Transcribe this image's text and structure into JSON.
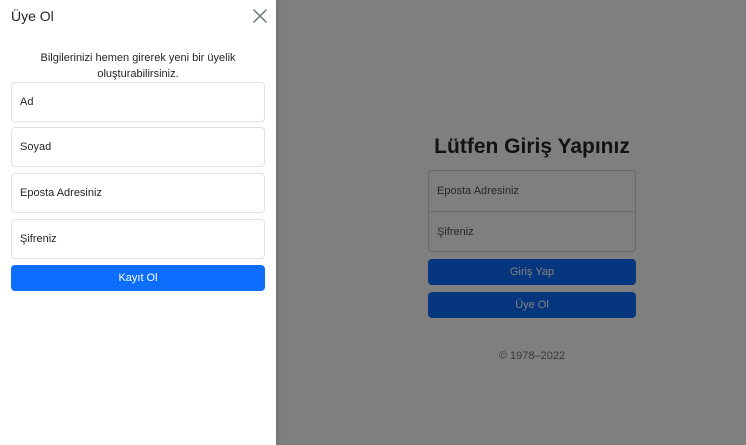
{
  "login": {
    "title": "Lütfen Giriş Yapınız",
    "email_placeholder": "Eposta Adresiniz",
    "password_placeholder": "Şifreniz",
    "login_button": "Giriş Yap",
    "register_button": "Üye Ol",
    "copyright": "© 1978–2022"
  },
  "offcanvas": {
    "title": "Üye Ol",
    "close_icon": "close-icon",
    "description": "Bilgilerinizi hemen girerek yeni bir üyelik oluşturabilirsiniz.",
    "first_name_placeholder": "Ad",
    "last_name_placeholder": "Soyad",
    "email_placeholder": "Eposta Adresiniz",
    "password_placeholder": "Şifreniz",
    "submit_button": "Kayıt Ol"
  },
  "colors": {
    "primary": "#0d6efd",
    "backdrop": "rgba(0,0,0,0.5)"
  }
}
